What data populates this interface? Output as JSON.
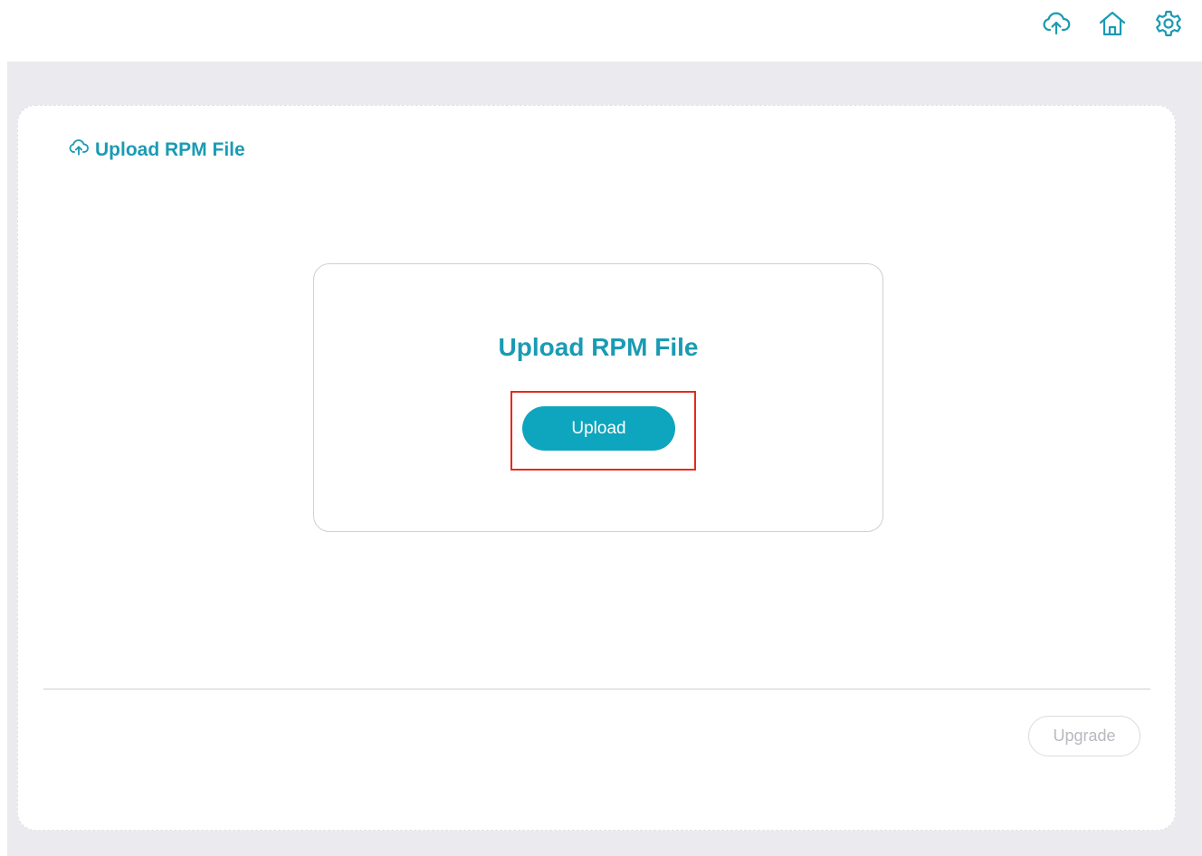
{
  "topbar": {
    "icons": [
      "cloud-upload-icon",
      "home-icon",
      "gear-icon"
    ]
  },
  "panel": {
    "header_title": "Upload RPM File",
    "header_icon": "cloud-upload-icon"
  },
  "card": {
    "title": "Upload RPM File",
    "upload_button_label": "Upload"
  },
  "footer": {
    "upgrade_button_label": "Upgrade",
    "upgrade_disabled": true
  },
  "colors": {
    "accent": "#1a9bb3",
    "button": "#0ea5be",
    "highlight": "#e8291c",
    "background": "#ebebef"
  }
}
